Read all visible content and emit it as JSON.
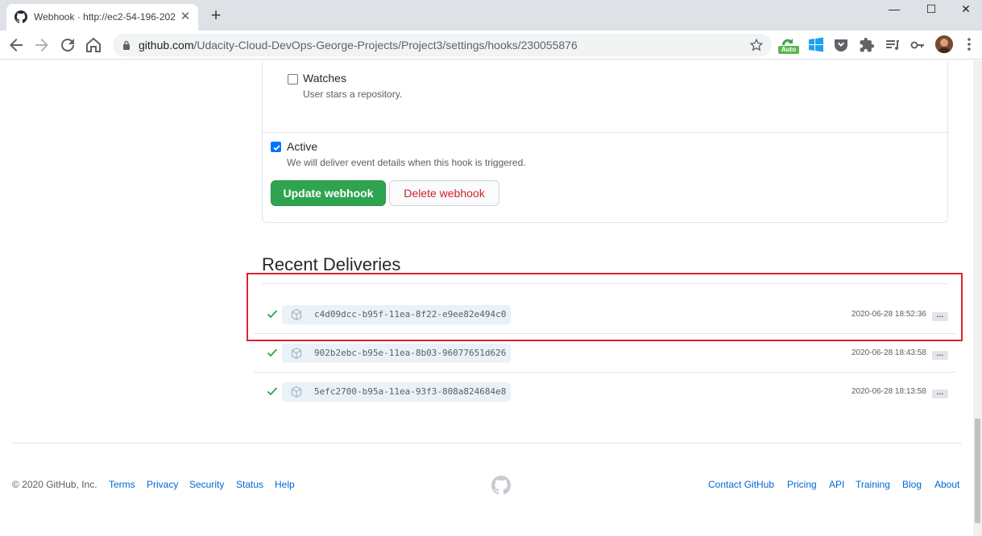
{
  "browser": {
    "tab_title": "Webhook · http://ec2-54-196-202-",
    "url_host": "github.com",
    "url_path": "/Udacity-Cloud-DevOps-George-Projects/Project3/settings/hooks/230055876",
    "extension_badge": "Auto"
  },
  "form": {
    "watches_label": "Watches",
    "watches_note": "User stars a repository.",
    "active_label": "Active",
    "active_note": "We will deliver event details when this hook is triggered.",
    "update_button": "Update webhook",
    "delete_button": "Delete webhook"
  },
  "deliveries": {
    "title": "Recent Deliveries",
    "items": [
      {
        "guid": "c4d09dcc-b95f-11ea-8f22-e9ee82e494c0",
        "timestamp": "2020-06-28 18:52:36",
        "status": "success"
      },
      {
        "guid": "902b2ebc-b95e-11ea-8b03-96077651d626",
        "timestamp": "2020-06-28 18:43:58",
        "status": "success"
      },
      {
        "guid": "5efc2700-b95a-11ea-93f3-808a824684e8",
        "timestamp": "2020-06-28 18:13:58",
        "status": "success"
      }
    ],
    "more_label": "…"
  },
  "footer": {
    "copyright": "© 2020 GitHub, Inc.",
    "left_links": [
      "Terms",
      "Privacy",
      "Security",
      "Status",
      "Help"
    ],
    "right_links": [
      "Contact GitHub",
      "Pricing",
      "API",
      "Training",
      "Blog",
      "About"
    ]
  },
  "colors": {
    "primary_green": "#2ea44f",
    "danger_red": "#cb2431",
    "link_blue": "#0366d6",
    "annotation_red": "#d7262e"
  }
}
